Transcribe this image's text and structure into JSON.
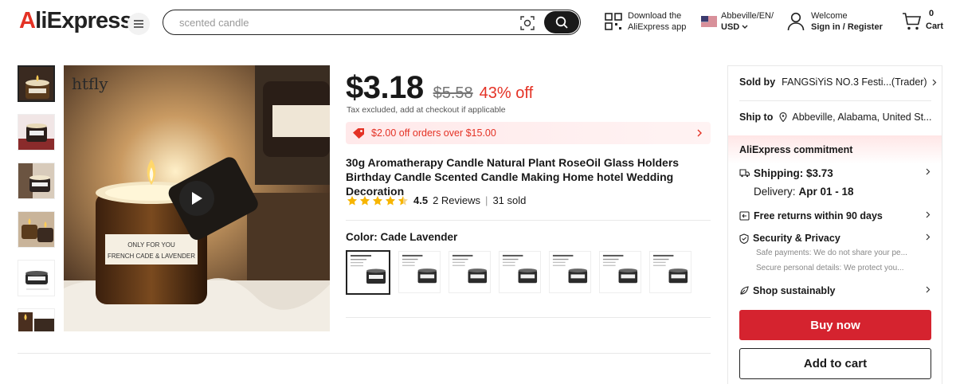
{
  "header": {
    "logo": "AliExpress",
    "search_placeholder": "scented candle",
    "download_line1": "Download the",
    "download_line2": "AliExpress app",
    "locale_line1": "Abbeville/EN/",
    "locale_line2": "USD",
    "welcome_line1": "Welcome",
    "welcome_line2": "Sign in / Register",
    "cart_count": "0",
    "cart_label": "Cart"
  },
  "gallery": {
    "brand_mark": "htfly",
    "label_line1": "ONLY FOR YOU",
    "label_line2": "FRENCH CADE & LAVENDER",
    "thumb_count": 6,
    "active_thumb": 0
  },
  "product": {
    "price": "$3.18",
    "old_price": "$5.58",
    "discount": "43% off",
    "tax_note": "Tax excluded, add at checkout if applicable",
    "coupon": "$2.00 off orders over $15.00",
    "title": "30g Aromatherapy Candle Natural Plant RoseOil Glass Holders Birthday Candle Scented Candle Making Home hotel Wedding Decoration",
    "rating": "4.5",
    "rating_fraction": 0.9,
    "reviews": "2 Reviews",
    "sold": "31 sold",
    "color_label": "Color: Cade Lavender",
    "swatch_count": 7,
    "active_swatch": 0
  },
  "panel": {
    "sold_by_label": "Sold by",
    "sold_by_value": "FANGSiYiS NO.3 Festi...(Trader)",
    "ship_to_label": "Ship to",
    "ship_to_value": "Abbeville, Alabama, United St...",
    "commitment": "AliExpress commitment",
    "shipping": "Shipping: $3.73",
    "delivery_label": "Delivery:",
    "delivery_value": "Apr 01 - 18",
    "returns": "Free returns within 90 days",
    "security": "Security & Privacy",
    "security_line1": "Safe payments: We do not share your pe...",
    "security_line2": "Secure personal details: We protect you...",
    "sustain": "Shop sustainably",
    "buy_now": "Buy now",
    "add_to_cart": "Add to cart"
  },
  "colors": {
    "brand_red": "#e43225",
    "buy_red": "#d5232f",
    "star": "#f7b500",
    "dark": "#191919"
  }
}
